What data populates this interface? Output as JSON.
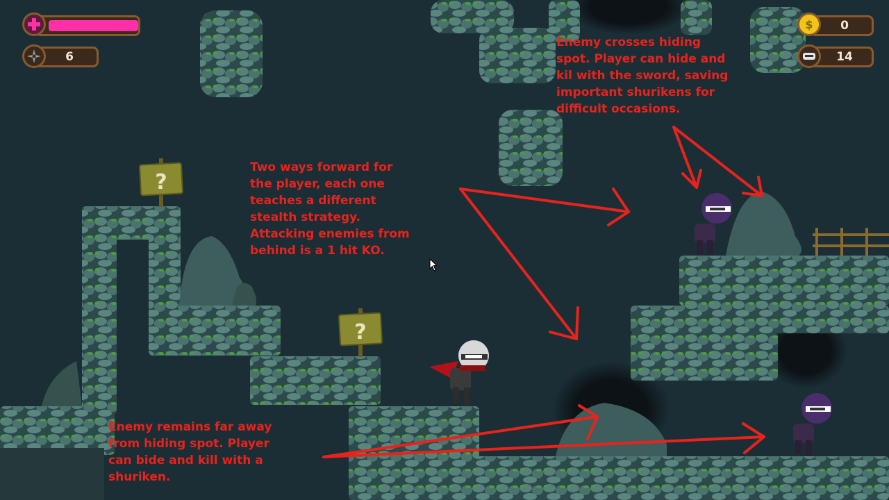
{
  "hud": {
    "health_fraction": 0.92,
    "shuriken_count": "6",
    "coin_count": "0",
    "ammo_count": "14",
    "icons": {
      "health": "health-cross-icon",
      "shuriken": "shuriken-icon",
      "coin": "coin-icon",
      "ammo": "ninja-mask-icon"
    },
    "colors": {
      "health_fill": "#ff2fa8",
      "frame": "#8a5a2e",
      "coin": "#f0c419"
    }
  },
  "annotations": {
    "top_right": "Enemy crosses hiding\nspot. Player can hide and\nkil with the sword, saving\nimportant shurikens for\ndifficult occasions.",
    "center": "Two ways forward for\nthe player, each one\nteaches a different\nstealth strategy.\nAttacking enemies from\nbehind is a 1 hit KO.",
    "bottom_left": "Enemy remains far away\nfrom hiding spot. Player\ncan bide and kill with a\nshuriken."
  },
  "signs": {
    "upper_symbol": "?",
    "lower_symbol": "?"
  },
  "colors": {
    "annotation": "#e8231c",
    "stone": "#4a6f6a",
    "moss": "#3f8a3a",
    "background": "#1b2e36"
  }
}
